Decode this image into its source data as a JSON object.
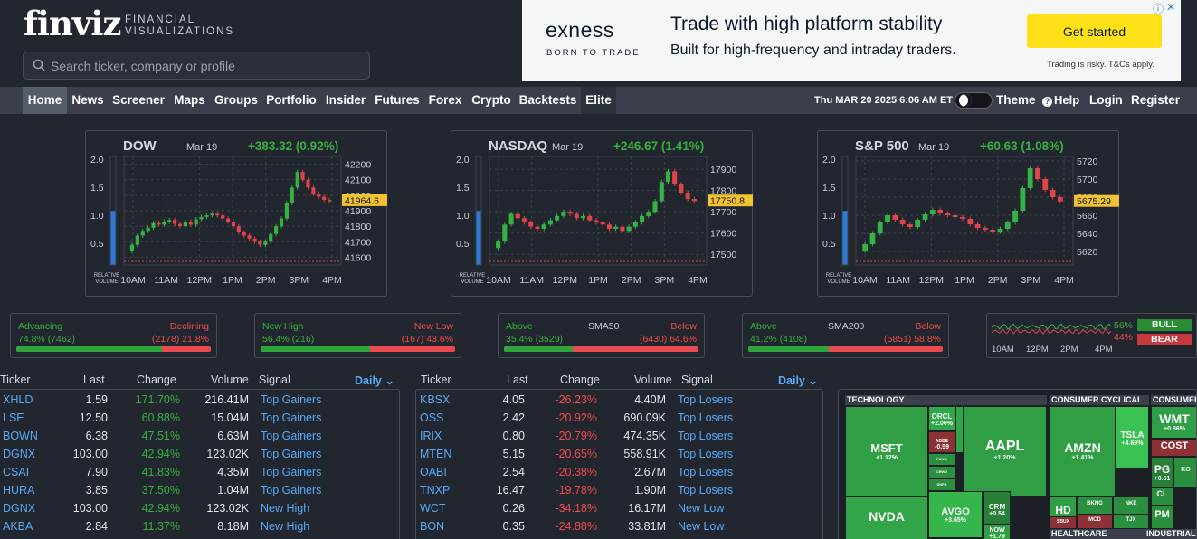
{
  "header": {
    "logo": "finviz",
    "logo_sub1": "FINANCIAL",
    "logo_sub2": "VISUALIZATIONS",
    "search_placeholder": "Search ticker, company or profile"
  },
  "ad": {
    "brand": "exness",
    "tagline": "BORN TO TRADE",
    "headline": "Trade with high platform stability",
    "subline": "Built for high-frequency and intraday traders.",
    "cta": "Get started",
    "disclaimer": "Trading is risky. T&Cs apply.",
    "info": "ⓘ",
    "close": "✕"
  },
  "nav": {
    "items": [
      "Home",
      "News",
      "Screener",
      "Maps",
      "Groups",
      "Portfolio",
      "Insider",
      "Futures",
      "Forex",
      "Crypto",
      "Backtests",
      "Elite"
    ],
    "selected": "Home",
    "datetime": "Thu MAR 20 2025 6:06 AM ET",
    "theme": "Theme",
    "help": "Help",
    "login": "Login",
    "register": "Register"
  },
  "indices": [
    {
      "name": "DOW",
      "date": "Mar 19",
      "change": "+383.32 (0.92%)",
      "last_label": "41964.6"
    },
    {
      "name": "NASDAQ",
      "date": "Mar 19",
      "change": "+246.67 (1.41%)",
      "last_label": "17750.8"
    },
    {
      "name": "S&P 500",
      "date": "Mar 19",
      "change": "+60.63 (1.08%)",
      "last_label": "5675.29"
    }
  ],
  "chart_data": [
    {
      "type": "candlestick",
      "title": "DOW",
      "ylim": [
        41550,
        42250
      ],
      "y_ticks": [
        "42200",
        "42100",
        "42000",
        "41900",
        "41800",
        "41700",
        "41600"
      ],
      "x_ticks": [
        "10AM",
        "11AM",
        "12PM",
        "1PM",
        "2PM",
        "3PM",
        "4PM"
      ],
      "rel_volume_ticks": [
        "2.0",
        "1.5",
        "1.0",
        "0.5"
      ],
      "rel_volume_label": "RELATIVE VOLUME",
      "rel_volume": 1.0,
      "last": 41964.6,
      "closes": [
        41680,
        41740,
        41770,
        41790,
        41820,
        41810,
        41830,
        41840,
        41815,
        41800,
        41830,
        41810,
        41845,
        41860,
        41870,
        41880,
        41870,
        41850,
        41830,
        41800,
        41760,
        41740,
        41720,
        41700,
        41680,
        41700,
        41750,
        41800,
        41850,
        41950,
        42050,
        42150,
        42100,
        42050,
        42010,
        41990,
        41970,
        41964.6
      ]
    },
    {
      "type": "candlestick",
      "title": "NASDAQ",
      "ylim": [
        17450,
        17960
      ],
      "y_ticks": [
        "17900",
        "17800",
        "17700",
        "17600",
        "17500"
      ],
      "x_ticks": [
        "10AM",
        "11AM",
        "12PM",
        "1PM",
        "2PM",
        "3PM",
        "4PM"
      ],
      "rel_volume_ticks": [
        "2.0",
        "1.5",
        "1.0",
        "0.5"
      ],
      "rel_volume_label": "RELATIVE VOLUME",
      "rel_volume": 1.0,
      "last": 17750.8,
      "closes": [
        17560,
        17640,
        17690,
        17670,
        17650,
        17630,
        17620,
        17640,
        17660,
        17680,
        17700,
        17690,
        17670,
        17680,
        17660,
        17650,
        17640,
        17620,
        17630,
        17610,
        17630,
        17650,
        17680,
        17700,
        17750,
        17840,
        17890,
        17830,
        17790,
        17760,
        17750.8
      ]
    },
    {
      "type": "candlestick",
      "title": "S&P 500",
      "ylim": [
        5605,
        5725
      ],
      "y_ticks": [
        "5720",
        "5700",
        "5680",
        "5660",
        "5640",
        "5620"
      ],
      "x_ticks": [
        "10AM",
        "11AM",
        "12PM",
        "1PM",
        "2PM",
        "3PM",
        "4PM"
      ],
      "rel_volume_ticks": [
        "2.0",
        "1.5",
        "1.0",
        "0.5"
      ],
      "rel_volume_label": "RELATIVE VOLUME",
      "rel_volume": 1.0,
      "last": 5675.29,
      "closes": [
        5628,
        5640,
        5652,
        5660,
        5655,
        5650,
        5647,
        5655,
        5661,
        5666,
        5662,
        5660,
        5658,
        5656,
        5650,
        5646,
        5644,
        5642,
        5645,
        5652,
        5665,
        5690,
        5712,
        5700,
        5688,
        5680,
        5675.29
      ]
    }
  ],
  "breadth": [
    {
      "left_label": "Advancing",
      "right_label": "Declining",
      "mid_label": "",
      "left_value": "74.8% (7462)",
      "right_value": "(2178) 21.8%",
      "fill": 0.748
    },
    {
      "left_label": "New High",
      "right_label": "New Low",
      "mid_label": "",
      "left_value": "56.4% (216)",
      "right_value": "(167) 43.6%",
      "fill": 0.564
    },
    {
      "left_label": "Above",
      "right_label": "Below",
      "mid_label": "SMA50",
      "left_value": "35.4% (3529)",
      "right_value": "(6430) 64.6%",
      "fill": 0.354
    },
    {
      "left_label": "Above",
      "right_label": "Below",
      "mid_label": "SMA200",
      "left_value": "41.2% (4108)",
      "right_value": "(5851) 58.8%",
      "fill": 0.412
    }
  ],
  "bullbear": {
    "bull_pct": "56%",
    "bear_pct": "44%",
    "bull": "BULL",
    "bear": "BEAR",
    "x_ticks": [
      "10AM",
      "12PM",
      "2PM",
      "4PM"
    ]
  },
  "tables": {
    "headers": [
      "Ticker",
      "Last",
      "Change",
      "Volume",
      "Signal"
    ],
    "daily": "Daily",
    "gainers": [
      {
        "ticker": "XHLD",
        "last": "1.59",
        "change": "171.70%",
        "volume": "216.41M",
        "signal": "Top Gainers"
      },
      {
        "ticker": "LSE",
        "last": "12.50",
        "change": "60.88%",
        "volume": "15.04M",
        "signal": "Top Gainers"
      },
      {
        "ticker": "BOWN",
        "last": "6.38",
        "change": "47.51%",
        "volume": "6.63M",
        "signal": "Top Gainers"
      },
      {
        "ticker": "DGNX",
        "last": "103.00",
        "change": "42.94%",
        "volume": "123.02K",
        "signal": "Top Gainers"
      },
      {
        "ticker": "CSAI",
        "last": "7.90",
        "change": "41.83%",
        "volume": "4.35M",
        "signal": "Top Gainers"
      },
      {
        "ticker": "HURA",
        "last": "3.85",
        "change": "37.50%",
        "volume": "1.04M",
        "signal": "Top Gainers"
      },
      {
        "ticker": "DGNX",
        "last": "103.00",
        "change": "42.94%",
        "volume": "123.02K",
        "signal": "New High"
      },
      {
        "ticker": "AKBA",
        "last": "2.84",
        "change": "11.37%",
        "volume": "8.18M",
        "signal": "New High"
      }
    ],
    "losers": [
      {
        "ticker": "KBSX",
        "last": "4.05",
        "change": "-26.23%",
        "volume": "4.40M",
        "signal": "Top Losers"
      },
      {
        "ticker": "OSS",
        "last": "2.42",
        "change": "-20.92%",
        "volume": "690.09K",
        "signal": "Top Losers"
      },
      {
        "ticker": "IRIX",
        "last": "0.80",
        "change": "-20.79%",
        "volume": "474.35K",
        "signal": "Top Losers"
      },
      {
        "ticker": "MTEN",
        "last": "5.15",
        "change": "-20.65%",
        "volume": "558.91K",
        "signal": "Top Losers"
      },
      {
        "ticker": "OABI",
        "last": "2.54",
        "change": "-20.38%",
        "volume": "2.67M",
        "signal": "Top Losers"
      },
      {
        "ticker": "TNXP",
        "last": "16.47",
        "change": "-19.78%",
        "volume": "1.90M",
        "signal": "Top Losers"
      },
      {
        "ticker": "WCT",
        "last": "0.26",
        "change": "-34.18%",
        "volume": "16.17M",
        "signal": "New Low"
      },
      {
        "ticker": "BON",
        "last": "0.35",
        "change": "-24.88%",
        "volume": "33.81M",
        "signal": "New Low"
      }
    ]
  },
  "heatmap": {
    "sectors": [
      "TECHNOLOGY",
      "CONSUMER CYCLICAL",
      "CONSUMER",
      "HEALTHCARE",
      "INDUSTRIALS"
    ],
    "cells": [
      {
        "t": "MSFT",
        "p": "+1.12%",
        "c": "#2f9e44"
      },
      {
        "t": "ORCL",
        "p": "+2.06%",
        "c": "#2fa84a"
      },
      {
        "t": "ADBE",
        "p": "-0.59",
        "c": "#8e3135"
      },
      {
        "t": "CRM",
        "p": "+2.63",
        "c": "#30a648"
      },
      {
        "t": "PANW",
        "p": "",
        "c": "#2a8f3e"
      },
      {
        "t": "CRWD",
        "p": "",
        "c": "#2a8f3e"
      },
      {
        "t": "SNPS",
        "p": "",
        "c": "#2a8f3e"
      },
      {
        "t": "AAPL",
        "p": "+1.20%",
        "c": "#2f9e44"
      },
      {
        "t": "AVGO",
        "p": "+3.65%",
        "c": "#35b64c"
      },
      {
        "t": "CRM",
        "p": "+0.54",
        "c": "#287f38"
      },
      {
        "t": "NOW",
        "p": "+1.79",
        "c": "#2f9e44"
      },
      {
        "t": "NVDA",
        "p": "",
        "c": "#31a547"
      },
      {
        "t": "AMZN",
        "p": "+1.41%",
        "c": "#2f9e44"
      },
      {
        "t": "TSLA",
        "p": "+4.69%",
        "c": "#39c251"
      },
      {
        "t": "HD",
        "p": "+1.50",
        "c": "#2f9e44"
      },
      {
        "t": "BKNG",
        "p": "",
        "c": "#2a8f3e"
      },
      {
        "t": "MCD",
        "p": "",
        "c": "#8e3135"
      },
      {
        "t": "NKE",
        "p": "",
        "c": "#2a8f3e"
      },
      {
        "t": "TJX",
        "p": "",
        "c": "#2a8f3e"
      },
      {
        "t": "SBUX",
        "p": "",
        "c": "#8e3135"
      },
      {
        "t": "WMT",
        "p": "+0.86%",
        "c": "#2f9e44"
      },
      {
        "t": "COST",
        "p": "",
        "c": "#8e3135"
      },
      {
        "t": "PG",
        "p": "+0.51",
        "c": "#287f38"
      },
      {
        "t": "KO",
        "p": "",
        "c": "#2a8f3e"
      },
      {
        "t": "CL",
        "p": "",
        "c": "#2a8f3e"
      },
      {
        "t": "PM",
        "p": "",
        "c": "#2a8f3e"
      }
    ]
  }
}
